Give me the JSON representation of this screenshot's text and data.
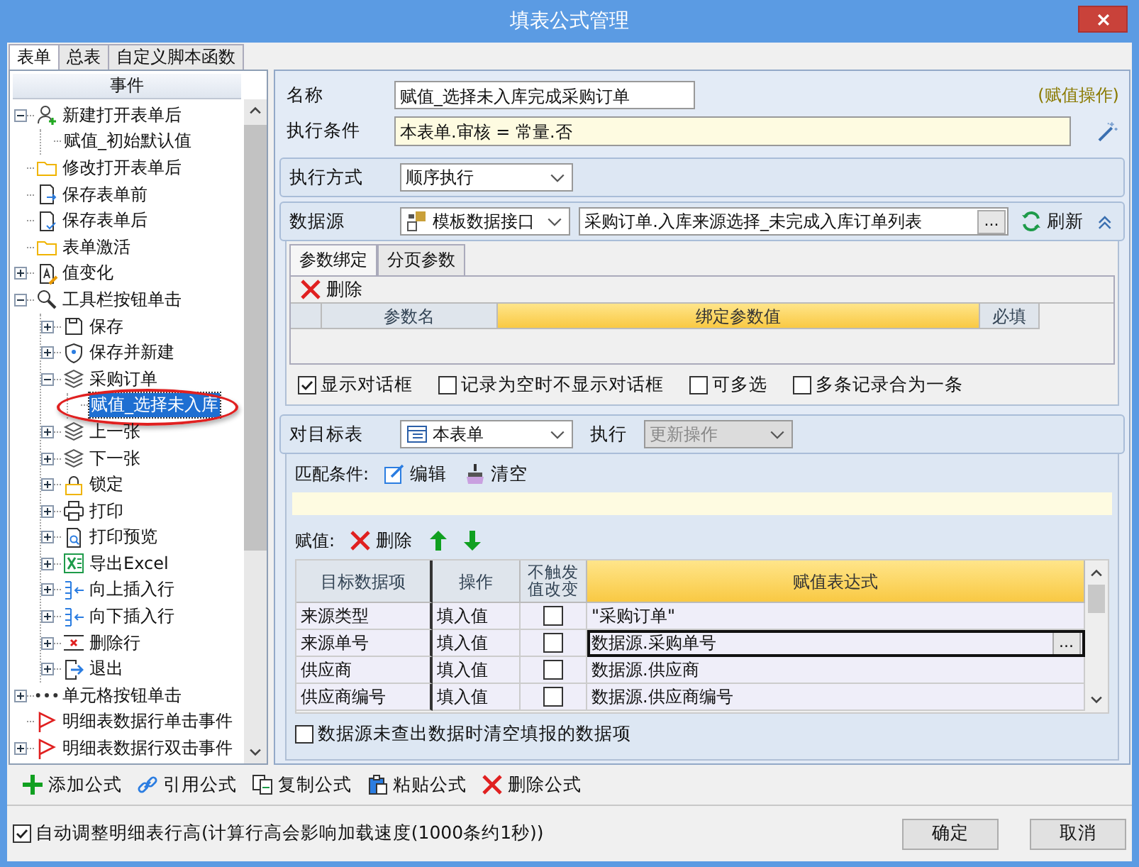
{
  "window": {
    "title": "填表公式管理"
  },
  "tabs": [
    {
      "label": "表单",
      "selected": true
    },
    {
      "label": "总表",
      "selected": false
    },
    {
      "label": "自定义脚本函数",
      "selected": false
    }
  ],
  "event_tree": {
    "header": "事件",
    "items": [
      {
        "label": "新建打开表单后",
        "kind": "user",
        "expanded": true,
        "selected": false,
        "children": [
          {
            "label": "赋值_初始默认值",
            "selected": false
          }
        ]
      },
      {
        "label": "修改打开表单后",
        "kind": "folder",
        "selected": false
      },
      {
        "label": "保存表单前",
        "kind": "save-in",
        "selected": false
      },
      {
        "label": "保存表单后",
        "kind": "save-check",
        "selected": false
      },
      {
        "label": "表单激活",
        "kind": "folder",
        "selected": false
      },
      {
        "label": "值变化",
        "kind": "value",
        "expanded": false,
        "selected": false
      },
      {
        "label": "工具栏按钮单击",
        "kind": "tool",
        "expanded": true,
        "selected": false,
        "children": [
          {
            "label": "保存",
            "kind": "save",
            "expanded": false,
            "selected": false
          },
          {
            "label": "保存并新建",
            "kind": "shield",
            "expanded": false,
            "selected": false
          },
          {
            "label": "采购订单",
            "kind": "layers",
            "expanded": true,
            "selected": false,
            "children": [
              {
                "label": "赋值_选择未入库",
                "selected": true
              }
            ]
          },
          {
            "label": "上一张",
            "kind": "layers",
            "expanded": false,
            "selected": false
          },
          {
            "label": "下一张",
            "kind": "layers",
            "expanded": false,
            "selected": false
          },
          {
            "label": "锁定",
            "kind": "lock",
            "expanded": false,
            "selected": false
          },
          {
            "label": "打印",
            "kind": "print",
            "expanded": false,
            "selected": false
          },
          {
            "label": "打印预览",
            "kind": "preview",
            "expanded": false,
            "selected": false
          },
          {
            "label": "导出Excel",
            "kind": "excel",
            "expanded": false,
            "selected": false
          },
          {
            "label": "向上插入行",
            "kind": "insert",
            "expanded": false,
            "selected": false
          },
          {
            "label": "向下插入行",
            "kind": "insert",
            "expanded": false,
            "selected": false
          },
          {
            "label": "删除行",
            "kind": "deleterow",
            "expanded": false,
            "selected": false
          },
          {
            "label": "退出",
            "kind": "exit",
            "expanded": false,
            "selected": false
          }
        ]
      },
      {
        "label": "单元格按钮单击",
        "kind": "dots",
        "expanded": false,
        "selected": false
      },
      {
        "label": "明细表数据行单击事件",
        "kind": "flag",
        "selected": false
      },
      {
        "label": "明细表数据行双击事件",
        "kind": "flag",
        "expanded": false,
        "selected": false
      }
    ]
  },
  "formula": {
    "name_label": "名称",
    "name_value": "赋值_选择未入库完成采购订单",
    "type_note": "(赋值操作)",
    "condition_label": "执行条件",
    "condition_value": "本表单.审核 = 常量.否"
  },
  "execution": {
    "label": "执行方式",
    "value": "顺序执行"
  },
  "data_source": {
    "label": "数据源",
    "type_value": "模板数据接口",
    "source_value": "采购订单.入库来源选择_未完成入库订单列表",
    "browse_label": "...",
    "refresh_label": "刷新",
    "tabs": [
      {
        "label": "参数绑定",
        "selected": true
      },
      {
        "label": "分页参数",
        "selected": false
      }
    ],
    "delete_label": "删除",
    "columns": [
      {
        "label": "参数名",
        "selected": false
      },
      {
        "label": "绑定参数值",
        "selected": true
      },
      {
        "label": "必填",
        "selected": false
      }
    ],
    "options": [
      {
        "label": "显示对话框",
        "checked": true
      },
      {
        "label": "记录为空时不显示对话框",
        "checked": false
      },
      {
        "label": "可多选",
        "checked": false
      },
      {
        "label": "多条记录合为一条",
        "checked": false
      }
    ]
  },
  "target": {
    "label": "对目标表",
    "table_value": "本表单",
    "exec_label": "执行",
    "exec_value": "更新操作",
    "exec_disabled": true,
    "match_label": "匹配条件:",
    "edit_label": "编辑",
    "clear_label": "清空",
    "assign_label": "赋值:",
    "delete_label": "删除",
    "cell_button_label": "...",
    "columns": [
      {
        "label": "目标数据项",
        "selected": false
      },
      {
        "label": "操作",
        "selected": false
      },
      {
        "label": "不触发值改变",
        "selected": false
      },
      {
        "label": "赋值表达式",
        "selected": true
      }
    ],
    "rows": [
      {
        "item": "来源类型",
        "operation": "填入值",
        "no_trigger": false,
        "expression": "\"采购订单\"",
        "selected": false
      },
      {
        "item": "来源单号",
        "operation": "填入值",
        "no_trigger": false,
        "expression": "数据源.采购单号",
        "selected": true
      },
      {
        "item": "供应商",
        "operation": "填入值",
        "no_trigger": false,
        "expression": "数据源.供应商",
        "selected": false
      },
      {
        "item": "供应商编号",
        "operation": "填入值",
        "no_trigger": false,
        "expression": "数据源.供应商编号",
        "selected": false
      }
    ],
    "clear_option": {
      "label": "数据源未查出数据时清空填报的数据项",
      "checked": false
    }
  },
  "toolbar": [
    {
      "label": "添加公式",
      "kind": "add"
    },
    {
      "label": "引用公式",
      "kind": "link"
    },
    {
      "label": "复制公式",
      "kind": "copy"
    },
    {
      "label": "粘贴公式",
      "kind": "paste"
    },
    {
      "label": "删除公式",
      "kind": "delete"
    }
  ],
  "auto_height": {
    "label": "自动调整明细表行高(计算行高会影响加载速度(1000条约1秒))",
    "checked": true
  },
  "buttons": [
    "确定",
    "取消"
  ]
}
